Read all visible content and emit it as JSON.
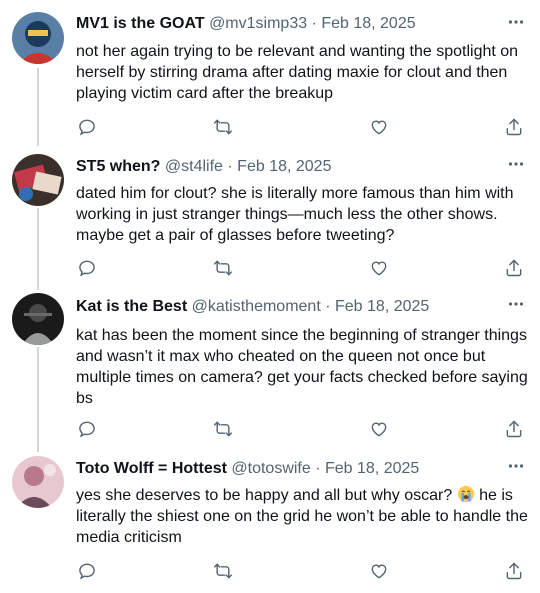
{
  "tweets": [
    {
      "name": "MV1 is the GOAT",
      "handle": "@mv1simp33",
      "date": "Feb 18, 2025",
      "text": "not her again trying to be relevant and wanting the spotlight on herself by stirring drama after dating maxie for clout and then playing victim card after the breakup",
      "avatar_colors": [
        "#1d3a5c",
        "#c7362f",
        "#f2c14e"
      ]
    },
    {
      "name": "ST5 when?",
      "handle": "@st4life",
      "date": "Feb 18, 2025",
      "text": "dated him for clout? she is literally more famous than him with working in just stranger things—much less the other shows. maybe get a pair of glasses before tweeting?",
      "avatar_colors": [
        "#3a2f2a",
        "#c23a4a",
        "#e9d9c9"
      ]
    },
    {
      "name": "Kat is the Best",
      "handle": "@katisthemoment",
      "date": "Feb 18, 2025",
      "text": "kat has been the moment since the beginning of stranger things and wasn’t it max who cheated on the queen not once but multiple times on camera? get your facts checked before saying bs",
      "avatar_colors": [
        "#1a1a1a",
        "#4a4a4a",
        "#9a9a9a"
      ]
    },
    {
      "name": "Toto Wolff = Hottest",
      "handle": "@totoswife",
      "date": "Feb 18, 2025",
      "text_before_emoji": "yes she deserves to be happy and all but why oscar? ",
      "emoji": "loudly-crying-face",
      "text_after_emoji": " he is literally the shiest one on the grid he won’t be able to handle the media criticism",
      "avatar_colors": [
        "#b87a8a",
        "#6d4a5a",
        "#e8c8cf"
      ]
    }
  ],
  "separator": " · ",
  "colors": {
    "text_primary": "#0f1419",
    "text_secondary": "#536471",
    "thread_line": "#cfd9de"
  },
  "icons": [
    "more-icon",
    "reply-icon",
    "retweet-icon",
    "like-icon",
    "share-icon"
  ]
}
